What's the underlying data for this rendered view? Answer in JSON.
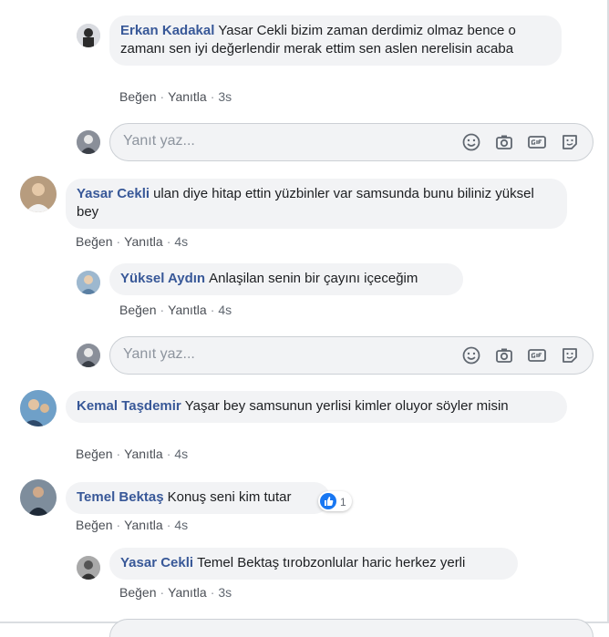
{
  "comments": [
    {
      "id": "c1",
      "author": "Erkan Kadakal",
      "text": "Yasar Cekli bizim zaman derdimiz olmaz bence o zamanı sen iyi değerlendir merak ettim sen aslen nerelisin acaba",
      "like_label": "Beğen",
      "reply_label": "Yanıtla",
      "time": "3s"
    },
    {
      "id": "c2",
      "author": "Yasar Cekli",
      "text": "ulan diye hitap ettin yüzbinler var samsunda bunu biliniz yüksel bey",
      "like_label": "Beğen",
      "reply_label": "Yanıtla",
      "time": "4s"
    },
    {
      "id": "c3",
      "author": "Yüksel Aydın",
      "text": "Anlaşilan senin bir çayını içeceğim",
      "like_label": "Beğen",
      "reply_label": "Yanıtla",
      "time": "4s"
    },
    {
      "id": "c4",
      "author": "Kemal Taşdemir",
      "text": "Yaşar bey samsunun yerlisi kimler oluyor söyler misin",
      "like_label": "Beğen",
      "reply_label": "Yanıtla",
      "time": "4s"
    },
    {
      "id": "c5",
      "author": "Temel Bektaş",
      "text": "Konuş seni kim tutar",
      "like_label": "Beğen",
      "reply_label": "Yanıtla",
      "time": "4s",
      "reaction_count": "1"
    },
    {
      "id": "c6",
      "author": "Yasar Cekli",
      "text": "Temel Bektaş tırobzonlular haric herkez yerli",
      "like_label": "Beğen",
      "reply_label": "Yanıtla",
      "time": "3s"
    }
  ],
  "reply_boxes": [
    {
      "placeholder": "Yanıt yaz..."
    },
    {
      "placeholder": "Yanıt yaz..."
    }
  ],
  "separator": "·",
  "icons": {
    "emoji": "smiley-icon",
    "photo": "camera-icon",
    "gif": "gif-icon",
    "sticker": "sticker-icon",
    "reaction": "like-reaction-icon"
  },
  "colors": {
    "author": "#385898",
    "bubble": "#f2f3f5",
    "meta": "#606770",
    "like_blue": "#1877f2"
  }
}
